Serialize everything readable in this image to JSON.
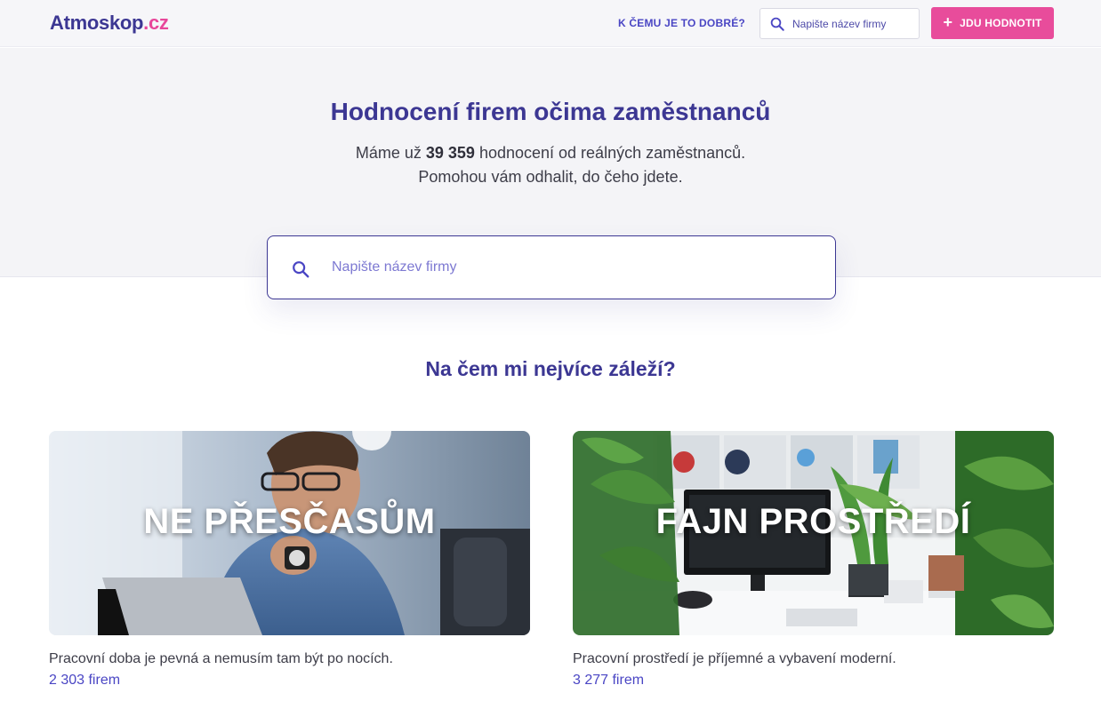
{
  "header": {
    "logo_main": "Atmoskop",
    "logo_tld": ".cz",
    "nav_link": "K ČEMU JE TO DOBRÉ?",
    "search_placeholder": "Napište název firmy",
    "rate_button": "JDU HODNOTIT"
  },
  "hero": {
    "title": "Hodnocení firem očima zaměstnanců",
    "sub_prefix": "Máme už",
    "review_count": "39 359",
    "sub_suffix": "hodnocení od reálných zaměstnanců.",
    "sub_line2": "Pomohou vám odhalit, do čeho jdete.",
    "search_placeholder": "Napište název firmy"
  },
  "section": {
    "title": "Na čem mi nejvíce záleží?"
  },
  "cards": [
    {
      "overlay": "NE PŘESČASŮM",
      "description": "Pracovní doba je pevná a nemusím tam být po nocích.",
      "count": "2 303 firem"
    },
    {
      "overlay": "FAJN PROSTŘEDÍ",
      "description": "Pracovní prostředí je příjemné a vybavení moderní.",
      "count": "3 277 firem"
    }
  ],
  "colors": {
    "brand": "#3c3793",
    "accent": "#e84c9b",
    "link": "#4a46c4"
  }
}
